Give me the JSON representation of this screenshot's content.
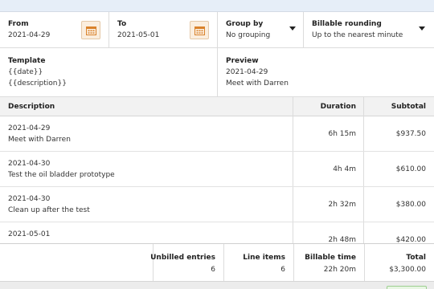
{
  "filters": {
    "from": {
      "label": "From",
      "value": "2021-04-29"
    },
    "to": {
      "label": "To",
      "value": "2021-05-01"
    },
    "group_by": {
      "label": "Group by",
      "value": "No grouping"
    },
    "rounding": {
      "label": "Billable rounding",
      "value": "Up to the nearest minute"
    }
  },
  "template": {
    "label": "Template",
    "line1": "{{date}}",
    "line2": "{{description}}"
  },
  "preview": {
    "label": "Preview",
    "line1": "2021-04-29",
    "line2": "Meet with Darren"
  },
  "table": {
    "headers": {
      "description": "Description",
      "duration": "Duration",
      "subtotal": "Subtotal"
    },
    "rows": [
      {
        "date": "2021-04-29",
        "description": "Meet with Darren",
        "duration": "6h 15m",
        "subtotal": "$937.50"
      },
      {
        "date": "2021-04-30",
        "description": "Test the oil bladder prototype",
        "duration": "4h 4m",
        "subtotal": "$610.00"
      },
      {
        "date": "2021-04-30",
        "description": "Clean up after the test",
        "duration": "2h 32m",
        "subtotal": "$380.00"
      },
      {
        "date": "2021-05-01",
        "description": "",
        "duration": "2h 48m",
        "subtotal": "$420.00"
      }
    ]
  },
  "summary": {
    "unbilled_entries": {
      "label": "Unbilled entries",
      "value": "6"
    },
    "line_items": {
      "label": "Line items",
      "value": "6"
    },
    "billable_time": {
      "label": "Billable time",
      "value": "22h 20m"
    },
    "total": {
      "label": "Total",
      "value": "$3,300.00"
    }
  },
  "colors": {
    "calendar_accent": "#d9822b",
    "topbar": "#e6eef8"
  }
}
